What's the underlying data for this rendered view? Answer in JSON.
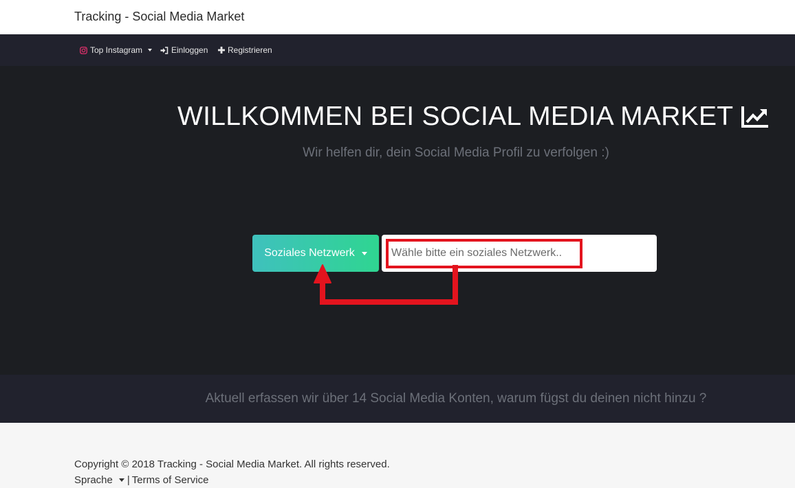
{
  "header": {
    "brand": "Tracking - Social Media Market"
  },
  "nav": {
    "items": [
      {
        "label": "Top Instagram",
        "icon": "instagram-icon"
      },
      {
        "label": "Einloggen",
        "icon": "sign-in-icon"
      },
      {
        "label": "Registrieren",
        "icon": "plus-icon"
      }
    ]
  },
  "hero": {
    "title": "WILLKOMMEN BEI SOCIAL MEDIA MARKET",
    "title_icon": "line-chart-icon",
    "subtitle": "Wir helfen dir, dein Social Media Profil zu verfolgen :)"
  },
  "search": {
    "network_button_label": "Soziales Netzwerk",
    "input_placeholder": "Wähle bitte ein soziales Netzwerk.."
  },
  "stats": {
    "text": "Aktuell erfassen wir über 14 Social Media Konten, warum fügst du deinen nicht hinzu ?"
  },
  "footer": {
    "copyright": "Copyright © 2018 Tracking - Social Media Market. All rights reserved.",
    "language_label": "Sprache",
    "separator": "|",
    "terms_label": "Terms of Service"
  },
  "colors": {
    "navbar_bg": "#21222d",
    "hero_bg": "#1c1e22",
    "button_gradient_start": "#3fc1bd",
    "button_gradient_end": "#2fd591",
    "annotation_red": "#e3141e",
    "instagram_pink": "#e1306c"
  }
}
